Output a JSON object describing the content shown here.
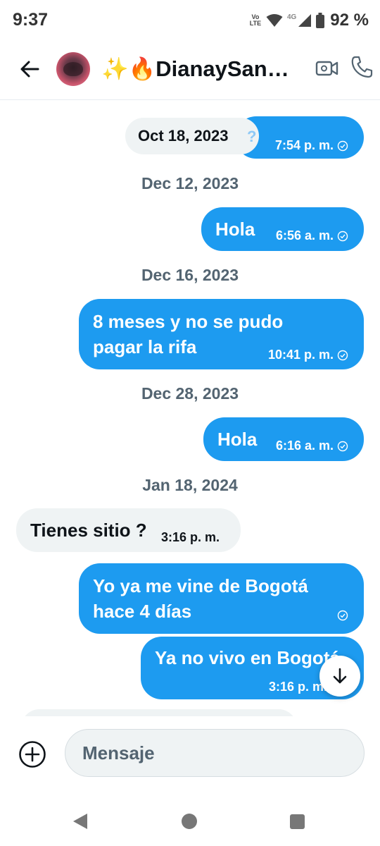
{
  "status_bar": {
    "time": "9:37",
    "volte_line1": "Vo",
    "volte_line2": "LTE",
    "network": "4G",
    "battery": "92 %"
  },
  "header": {
    "contact_name": "✨🔥DianaySan…",
    "icons": [
      "back-arrow-icon",
      "video-camera-icon",
      "phone-icon"
    ]
  },
  "chat": {
    "partial_date": "Oct 18, 2023",
    "partial_mark": "?",
    "messages": [
      {
        "direction": "out",
        "text": "",
        "time": "7:54 p. m."
      },
      {
        "separator": "Dec 12, 2023"
      },
      {
        "direction": "out",
        "text": "Hola",
        "time": "6:56 a. m."
      },
      {
        "separator": "Dec 16, 2023"
      },
      {
        "direction": "out",
        "text_line1": "8 meses y no se pudo",
        "text_line2": "pagar la rifa",
        "time": "10:41 p. m."
      },
      {
        "separator": "Dec 28, 2023"
      },
      {
        "direction": "out",
        "text": "Hola",
        "time": "6:16 a. m."
      },
      {
        "separator": "Jan 18, 2024"
      },
      {
        "direction": "in",
        "text": "Tienes sitio ?",
        "time": "3:16 p. m."
      },
      {
        "direction": "out",
        "text_line1": "Yo ya me vine de Bogotá",
        "text_line2": "hace 4 días",
        "time": ""
      },
      {
        "direction": "out",
        "text": "Ya no vivo en Bogotá",
        "time": "3:16 p. m."
      }
    ]
  },
  "composer": {
    "placeholder": "Mensaje"
  },
  "colors": {
    "outgoing_bubble": "#1d9bf0",
    "incoming_bubble": "#eff3f4",
    "date_separator": "#536471"
  }
}
